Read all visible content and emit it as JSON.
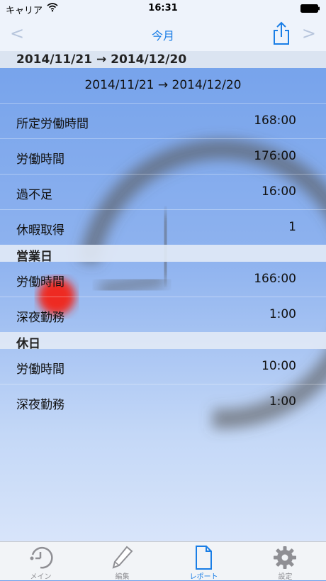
{
  "status_bar": {
    "carrier": "キャリア",
    "time": "16:31"
  },
  "nav": {
    "title": "今月",
    "back_glyph": "<",
    "forward_glyph": ">"
  },
  "period_header": "2014/11/21 → 2014/12/20",
  "period_range": "2014/11/21 → 2014/12/20",
  "summary": [
    {
      "label": "所定労働時間",
      "value": "168:00"
    },
    {
      "label": "労働時間",
      "value": "176:00"
    },
    {
      "label": "過不足",
      "value": "16:00"
    },
    {
      "label": "休暇取得",
      "value": "1"
    }
  ],
  "business_days": {
    "title": "営業日",
    "rows": [
      {
        "label": "労働時間",
        "value": "166:00"
      },
      {
        "label": "深夜勤務",
        "value": "1:00"
      }
    ]
  },
  "holidays": {
    "title": "休日",
    "rows": [
      {
        "label": "労働時間",
        "value": "10:00"
      },
      {
        "label": "深夜勤務",
        "value": "1:00"
      }
    ]
  },
  "tabs": [
    {
      "label": "メイン",
      "icon": "clock-icon"
    },
    {
      "label": "編集",
      "icon": "pencil-icon"
    },
    {
      "label": "レポート",
      "icon": "document-icon"
    },
    {
      "label": "設定",
      "icon": "gear-icon"
    }
  ],
  "colors": {
    "accent": "#1a7ee6",
    "inactive": "#8f8f94"
  }
}
